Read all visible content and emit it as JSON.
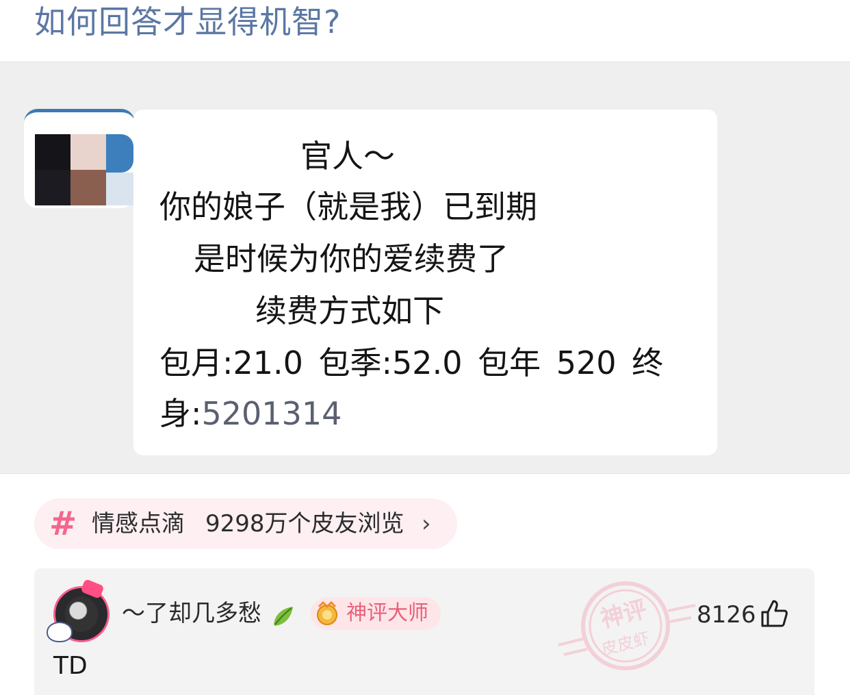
{
  "post": {
    "title": "如何回答才显得机智?"
  },
  "screenshot": {
    "message_lines": [
      "官人～",
      "你的娘子（就是我）已到期",
      "是时候为你的爱续费了",
      "续费方式如下",
      "包月:21.0  包季:52.0  包年 520   终",
      "身:"
    ],
    "message_number": "5201314"
  },
  "topic": {
    "icon": "hash-icon",
    "name": "情感点滴",
    "views": "9298万个皮友浏览",
    "chevron": "›"
  },
  "comment": {
    "username": "～了却几多愁",
    "badge": "神评大师",
    "likes": "8126",
    "text": "TD",
    "stamp": {
      "line1": "神评",
      "line2": "皮皮虾"
    }
  },
  "colors": {
    "title_blue": "#5b77a3",
    "topic_pink": "#f2688d",
    "badge_pink": "#e8607a",
    "stamp_pink": "#f4b4c2"
  }
}
